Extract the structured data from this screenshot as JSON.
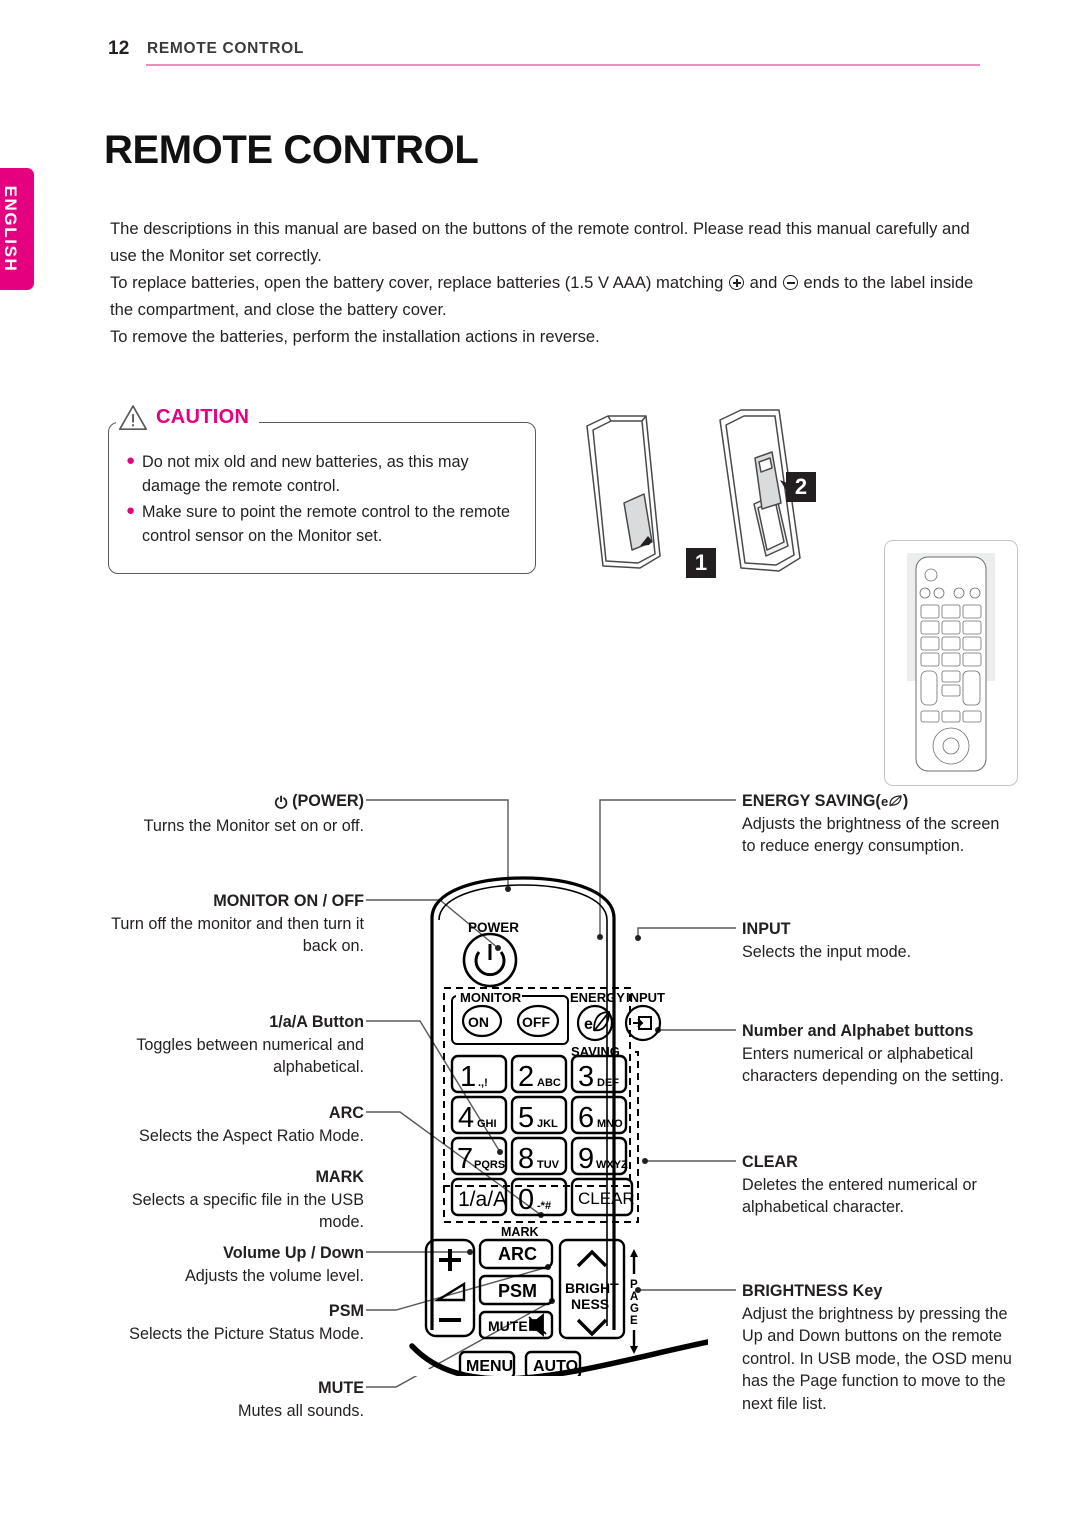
{
  "header": {
    "page_number": "12",
    "title": "REMOTE CONTROL",
    "rule_color": "#f08cbe"
  },
  "language_tab": {
    "label": "ENGLISH",
    "color": "#e4007f"
  },
  "main_title": "REMOTE CONTROL",
  "intro": {
    "p1": "The descriptions in this manual are based on the buttons of the remote control. Please read this manual carefully and use the Monitor set correctly.",
    "p2_a": "To replace batteries, open the battery cover, replace batteries (1.5 V AAA) matching ",
    "p2_b": " and ",
    "p2_c": " ends to the label inside the compartment, and close the battery cover.",
    "p3": "To remove the batteries, perform the installation actions in reverse."
  },
  "caution": {
    "label": "CAUTION",
    "accent_color": "#e4007f",
    "items": [
      "Do not mix old and new batteries, as this may damage the remote control.",
      "Make sure to point the remote control to the remote control sensor on the Monitor set."
    ]
  },
  "battery_illustration": {
    "step_1": "1",
    "step_2": "2"
  },
  "callouts_left": [
    {
      "title": "(POWER)",
      "icon": "power-icon",
      "body": "Turns the Monitor set on or off."
    },
    {
      "title": "MONITOR ON / OFF",
      "body": "Turn off the monitor and then turn it back on."
    },
    {
      "title": "1/a/A Button",
      "body": "Toggles between numerical and alphabetical."
    },
    {
      "title": "ARC",
      "body": "Selects the Aspect Ratio Mode."
    },
    {
      "title": "MARK",
      "body": "Selects a specific file in the USB mode."
    },
    {
      "title": "Volume Up / Down",
      "body": "Adjusts the volume level."
    },
    {
      "title": "PSM",
      "body": "Selects the Picture Status Mode."
    },
    {
      "title": "MUTE",
      "body": "Mutes all sounds."
    }
  ],
  "callouts_right": [
    {
      "title": "ENERGY SAVING(",
      "title_suffix": ")",
      "icon": "energy-saving-icon",
      "body": "Adjusts the brightness of the screen to reduce energy consumption."
    },
    {
      "title": "INPUT",
      "body": "Selects the input mode."
    },
    {
      "title": "Number and Alphabet buttons",
      "body": "Enters numerical or alphabetical characters depending on the setting."
    },
    {
      "title": "CLEAR",
      "body": "Deletes the entered numerical or alphabetical character."
    },
    {
      "title": "BRIGHTNESS Key",
      "body": "Adjust the brightness by pressing the Up and Down buttons on the remote control. In USB mode, the OSD menu has the Page function to move to the next file list."
    }
  ],
  "remote": {
    "power_label": "POWER",
    "monitor_label": "MONITOR",
    "monitor_on": "ON",
    "monitor_off": "OFF",
    "energy_label": "ENERGY",
    "saving_label": "SAVING",
    "input_label": "INPUT",
    "keys": [
      {
        "digit": "1",
        "sub": ".,!"
      },
      {
        "digit": "2",
        "sub": "ABC"
      },
      {
        "digit": "3",
        "sub": "DEF"
      },
      {
        "digit": "4",
        "sub": "GHI"
      },
      {
        "digit": "5",
        "sub": "JKL"
      },
      {
        "digit": "6",
        "sub": "MNO"
      },
      {
        "digit": "7",
        "sub": "PQRS"
      },
      {
        "digit": "8",
        "sub": "TUV"
      },
      {
        "digit": "9",
        "sub": "WXYZ"
      },
      {
        "digit": "1/a/A",
        "sub": ""
      },
      {
        "digit": "0",
        "sub": "-*#"
      },
      {
        "digit": "CLEAR",
        "sub": ""
      }
    ],
    "mark_label": "MARK",
    "arc_label": "ARC",
    "psm_label": "PSM",
    "mute_label": "MUTE",
    "brightness_label_1": "BRIGHT",
    "brightness_label_2": "NESS",
    "page_label": "PAGE",
    "volume_plus": "+",
    "volume_minus": "–",
    "menu_label": "MENU",
    "auto_label": "AUTO"
  }
}
